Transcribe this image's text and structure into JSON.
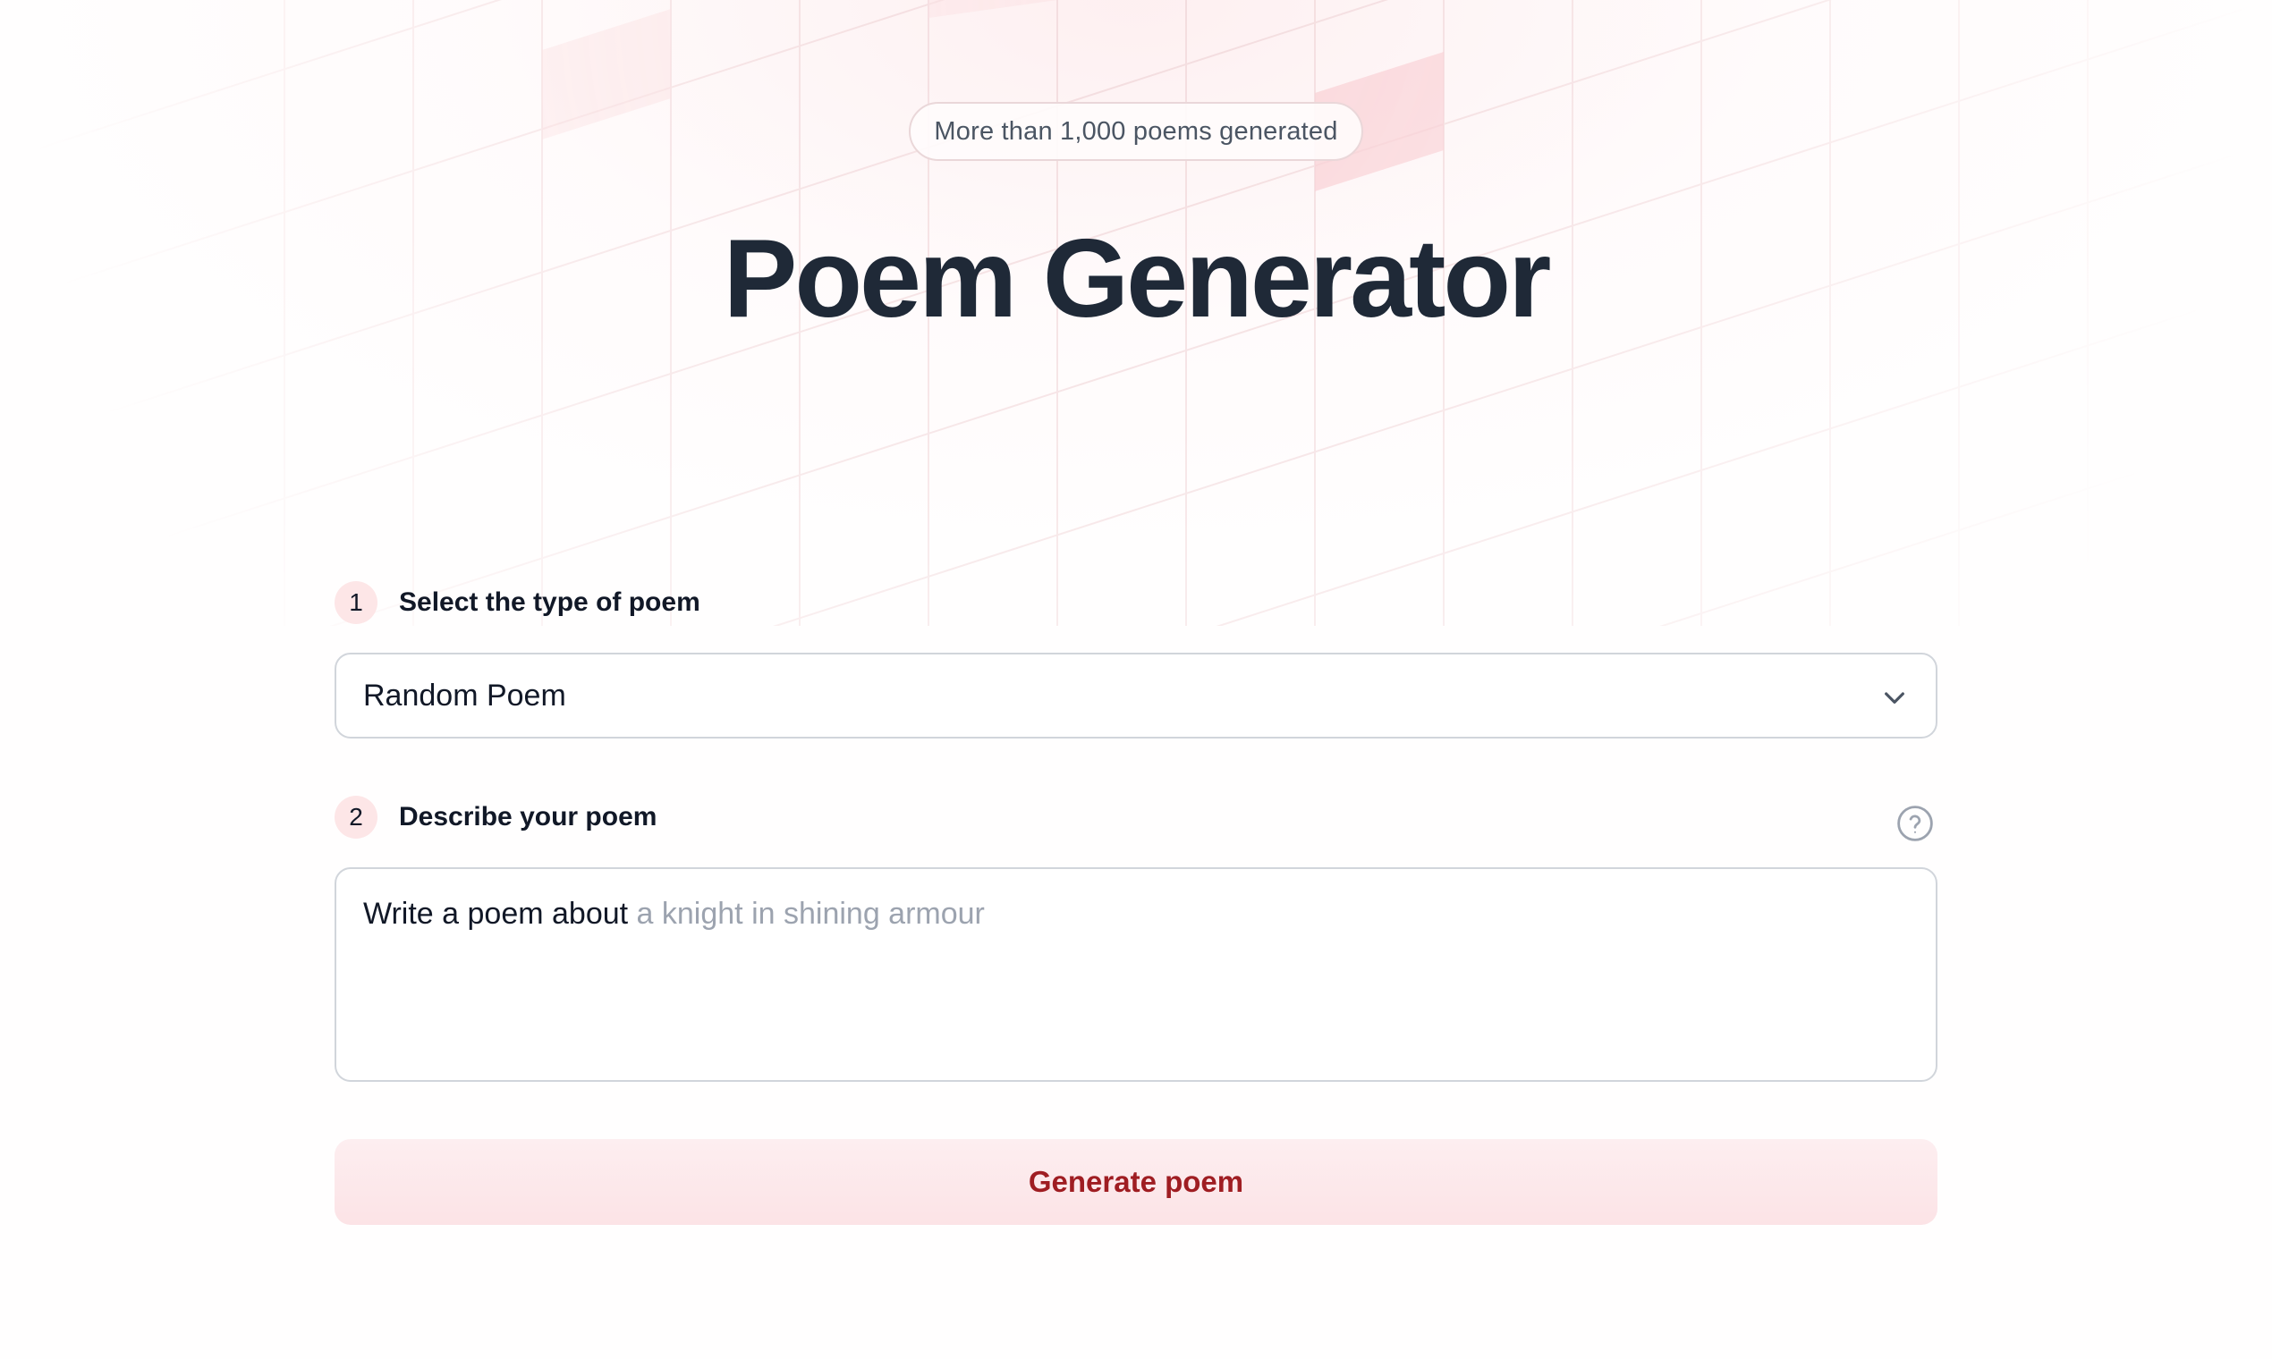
{
  "badge": {
    "text": "More than 1,000 poems generated"
  },
  "header": {
    "title": "Poem Generator"
  },
  "form": {
    "step1": {
      "number": "1",
      "label": "Select the type of poem",
      "selected_value": "Random Poem"
    },
    "step2": {
      "number": "2",
      "label": "Describe your poem",
      "prefix_text": "Write a poem about",
      "placeholder": "a knight in shining armour"
    },
    "submit_label": "Generate poem"
  },
  "icons": {
    "select_chevron": "chevron-down-icon",
    "help": "question-circle-icon"
  },
  "colors": {
    "accent_text": "#9f1d22",
    "accent_bg": "#fce3e6",
    "step_badge_bg": "#fde6e7",
    "title": "#1f2937"
  }
}
